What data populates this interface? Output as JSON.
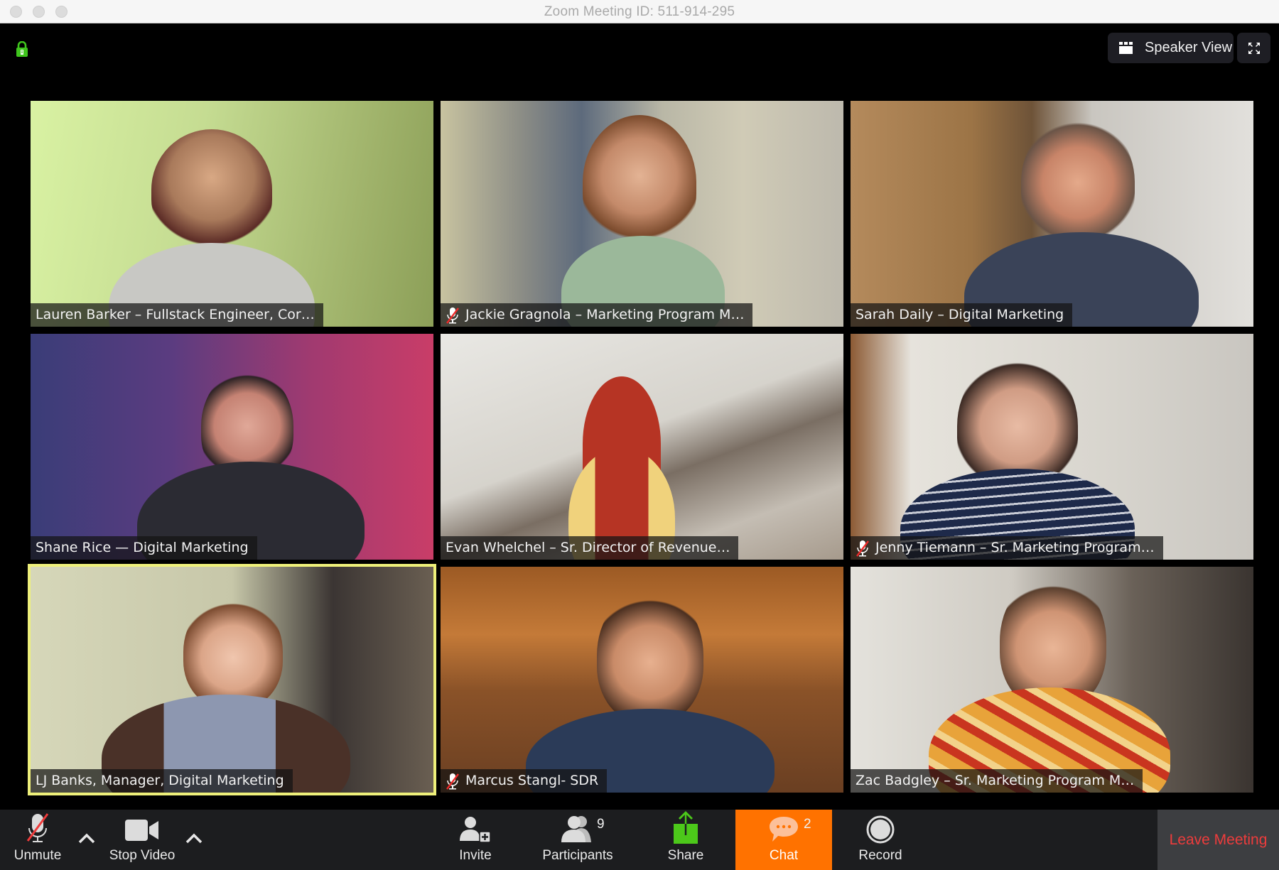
{
  "window": {
    "title": "Zoom Meeting ID: 511-914-295",
    "encryption_icon": "lock-icon",
    "encryption_color": "#3fc51d"
  },
  "view_controls": {
    "speaker_view_label": "Speaker View",
    "speaker_view_icon": "grid-icon",
    "fullscreen_icon": "fullscreen-icon"
  },
  "participants": [
    {
      "name": "Lauren Barker – Fullstack Engineer, Cor…",
      "muted": false,
      "active_speaker": false
    },
    {
      "name": "Jackie Gragnola – Marketing Program M…",
      "muted": true,
      "active_speaker": false
    },
    {
      "name": "Sarah Daily – Digital Marketing",
      "muted": false,
      "active_speaker": false
    },
    {
      "name": "Shane Rice — Digital Marketing",
      "muted": false,
      "active_speaker": false
    },
    {
      "name": "Evan Whelchel – Sr. Director of Revenue…",
      "muted": false,
      "active_speaker": false
    },
    {
      "name": "Jenny Tiemann – Sr. Marketing Program…",
      "muted": true,
      "active_speaker": false
    },
    {
      "name": "LJ Banks, Manager, Digital Marketing",
      "muted": false,
      "active_speaker": true
    },
    {
      "name": "Marcus Stangl- SDR",
      "muted": true,
      "active_speaker": false
    },
    {
      "name": "Zac Badgley – Sr. Marketing Program M…",
      "muted": false,
      "active_speaker": false
    }
  ],
  "toolbar": {
    "unmute": {
      "label": "Unmute",
      "icon": "muted-microphone-icon"
    },
    "stop_video": {
      "label": "Stop Video",
      "icon": "video-camera-icon"
    },
    "invite": {
      "label": "Invite",
      "icon": "invite-user-icon"
    },
    "participants": {
      "label": "Participants",
      "icon": "participants-icon",
      "count": "9"
    },
    "share": {
      "label": "Share",
      "icon": "share-screen-icon"
    },
    "chat": {
      "label": "Chat",
      "icon": "chat-bubble-icon",
      "unread": "2"
    },
    "record": {
      "label": "Record",
      "icon": "record-icon"
    },
    "leave": {
      "label": "Leave Meeting"
    }
  },
  "colors": {
    "active_speaker_border": "#eef07a",
    "chat_active": "#ff7200",
    "share_green": "#4cc81a",
    "leave_red": "#ee3c3c"
  }
}
